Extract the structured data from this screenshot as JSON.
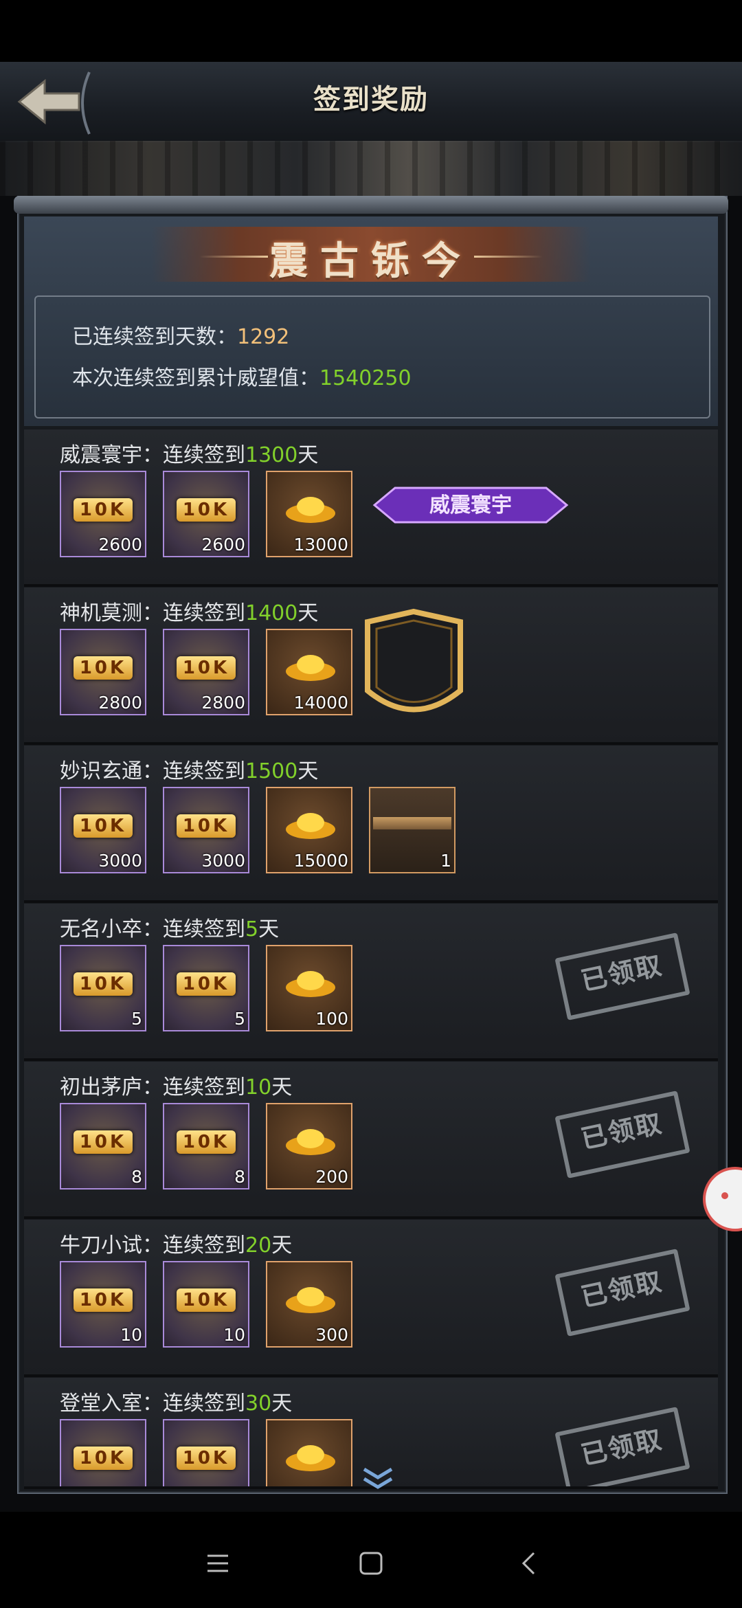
{
  "header": {
    "title": "签到奖励"
  },
  "banner": {
    "text": "震古铄今"
  },
  "summary": {
    "days_label": "已连续签到天数：",
    "days_value": "1292",
    "prestige_label": "本次连续签到累计威望值：",
    "prestige_value": "1540250"
  },
  "rows": [
    {
      "name": "威震寰宇：连续签到",
      "days": "1300",
      "unit": "天",
      "counts": [
        "2600",
        "2600",
        "13000"
      ],
      "extra": "威震寰宇",
      "claimed": false
    },
    {
      "name": "神机莫测：连续签到",
      "days": "1400",
      "unit": "天",
      "counts": [
        "2800",
        "2800",
        "14000"
      ],
      "claimed": false
    },
    {
      "name": "妙识玄通：连续签到",
      "days": "1500",
      "unit": "天",
      "counts": [
        "3000",
        "3000",
        "15000",
        "1"
      ],
      "claimed": false
    },
    {
      "name": "无名小卒：连续签到",
      "days": "5",
      "unit": "天",
      "counts": [
        "5",
        "5",
        "100"
      ],
      "claimed": true
    },
    {
      "name": "初出茅庐：连续签到",
      "days": "10",
      "unit": "天",
      "counts": [
        "8",
        "8",
        "200"
      ],
      "claimed": true
    },
    {
      "name": "牛刀小试：连续签到",
      "days": "20",
      "unit": "天",
      "counts": [
        "10",
        "10",
        "300"
      ],
      "claimed": true
    },
    {
      "name": "登堂入室：连续签到",
      "days": "30",
      "unit": "天",
      "counts": [
        "",
        "",
        ""
      ],
      "claimed": true
    }
  ],
  "item_label": "10K",
  "stamp_label": "已领取",
  "icons": {
    "back": "back-arrow-icon",
    "more": "double-chevron-down-icon",
    "menu": "menu-icon",
    "home": "home-icon",
    "nav_back": "nav-back-icon"
  }
}
